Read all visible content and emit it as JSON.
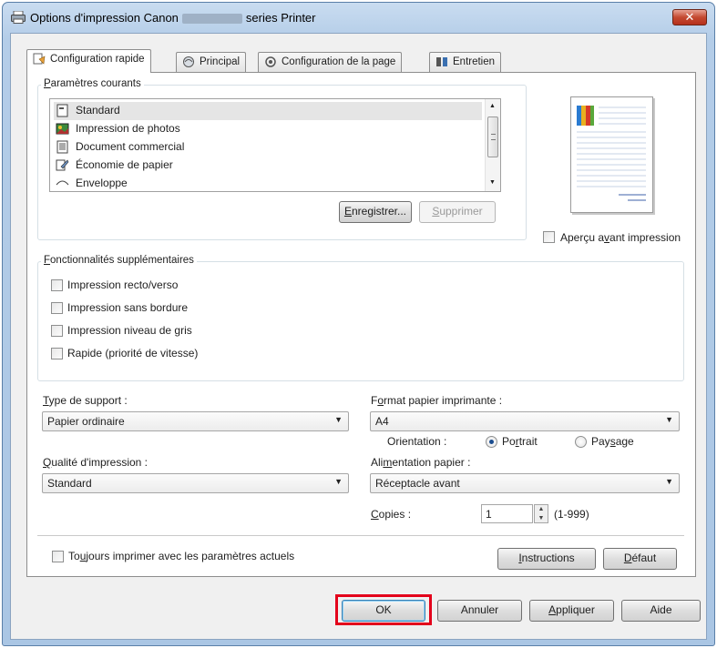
{
  "window": {
    "title_prefix": "Options d'impression Canon",
    "title_suffix": "series Printer",
    "close_label": "✕"
  },
  "tabs": [
    {
      "label": "Configuration rapide"
    },
    {
      "label": "Principal"
    },
    {
      "label": "Configuration de la page"
    },
    {
      "label": "Entretien"
    }
  ],
  "current_settings": {
    "title_first": "P",
    "title_rest": "aramètres courants",
    "items": [
      {
        "label": "Standard",
        "icon": "standard-icon"
      },
      {
        "label": "Impression de photos",
        "icon": "photo-icon"
      },
      {
        "label": "Document commercial",
        "icon": "document-icon"
      },
      {
        "label": "Économie de papier",
        "icon": "paper-saving-icon"
      },
      {
        "label": "Enveloppe",
        "icon": "envelope-icon"
      }
    ],
    "save_first": "E",
    "save_rest": "nregistrer...",
    "delete_first": "S",
    "delete_rest": "upprimer"
  },
  "preview": {
    "checkbox_label_a": "Aperçu a",
    "checkbox_label_u": "v",
    "checkbox_label_b": "ant impression"
  },
  "additional": {
    "title_first": "F",
    "title_rest": "onctionnalités supplémentaires",
    "options": [
      {
        "label": "Impression recto/verso"
      },
      {
        "label": "Impression sans bordure"
      },
      {
        "label": "Impression niveau de gris"
      },
      {
        "label": "Rapide (priorité de vitesse)"
      }
    ]
  },
  "media_type": {
    "label_first": "T",
    "label_rest": "ype de support :",
    "value": "Papier ordinaire"
  },
  "paper_size": {
    "label_a": "F",
    "label_u": "o",
    "label_b": "rmat papier imprimante :",
    "value": "A4"
  },
  "orientation": {
    "label": "Orientation :",
    "portrait_a": "Po",
    "portrait_u": "r",
    "portrait_b": "trait",
    "landscape_a": "Pay",
    "landscape_u": "s",
    "landscape_b": "age",
    "selected": "Portrait"
  },
  "print_quality": {
    "label_first": "Q",
    "label_rest": "ualité d'impression :",
    "value": "Standard"
  },
  "paper_source": {
    "label_a": "Ali",
    "label_u": "m",
    "label_b": "entation papier :",
    "value": "Réceptacle avant"
  },
  "copies": {
    "label_first": "C",
    "label_rest": "opies :",
    "value": "1",
    "range": "(1-999)"
  },
  "always_print": {
    "label_a": "To",
    "label_u": "u",
    "label_b": "jours imprimer avec les paramètres actuels"
  },
  "buttons": {
    "instructions_first": "I",
    "instructions_rest": "nstructions",
    "default_first": "D",
    "default_rest": "éfaut",
    "ok": "OK",
    "cancel": "Annuler",
    "apply_first": "A",
    "apply_rest": "ppliquer",
    "help": "Aide"
  },
  "colors": {
    "highlight_border": "#e3001b",
    "title_bar": "#b9d1ea",
    "close_button": "#c44a31"
  }
}
